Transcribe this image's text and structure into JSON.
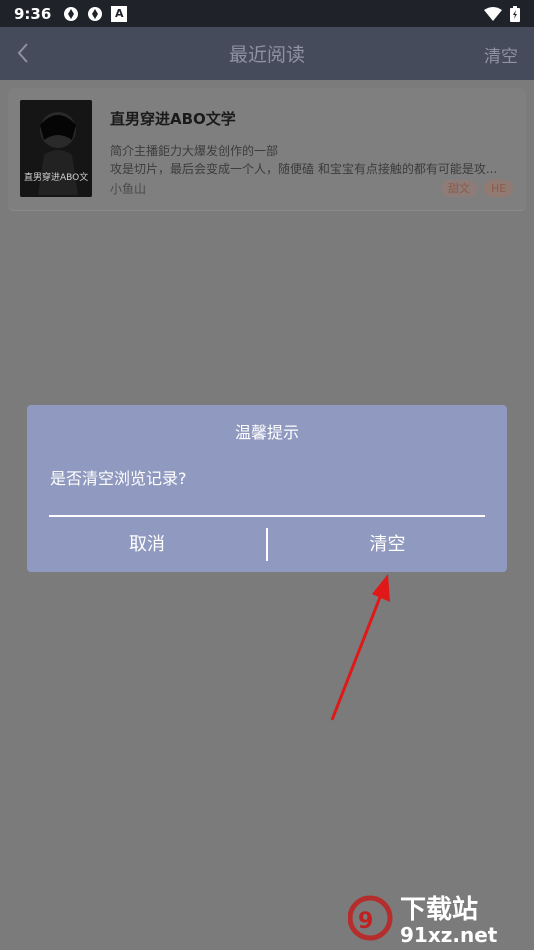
{
  "status_bar": {
    "time": "9:36",
    "text_icon": "A"
  },
  "nav": {
    "title": "最近阅读",
    "clear_label": "清空"
  },
  "book": {
    "title": "直男穿进ABO文学",
    "desc_line1": "简介主播鉅力大爆发创作的一部",
    "desc_line2": "攻是切片，最后会变成一个人，随便磕 和宝宝有点接触的都有可能是攻...",
    "author": "小鱼山",
    "tags": [
      "甜文",
      "HE"
    ],
    "cover_text": "直男穿进ABO文"
  },
  "dialog": {
    "title": "温馨提示",
    "message": "是否清空浏览记录?",
    "cancel_label": "取消",
    "confirm_label": "清空"
  },
  "watermark": {
    "logo_text": "下载站",
    "site": "91xz.net"
  },
  "colors": {
    "status_bar": "#1f2229",
    "nav_bar": "#464b5c",
    "dialog": "#9099bf",
    "overlay": "#7b7b7b",
    "arrow": "#e01818"
  }
}
